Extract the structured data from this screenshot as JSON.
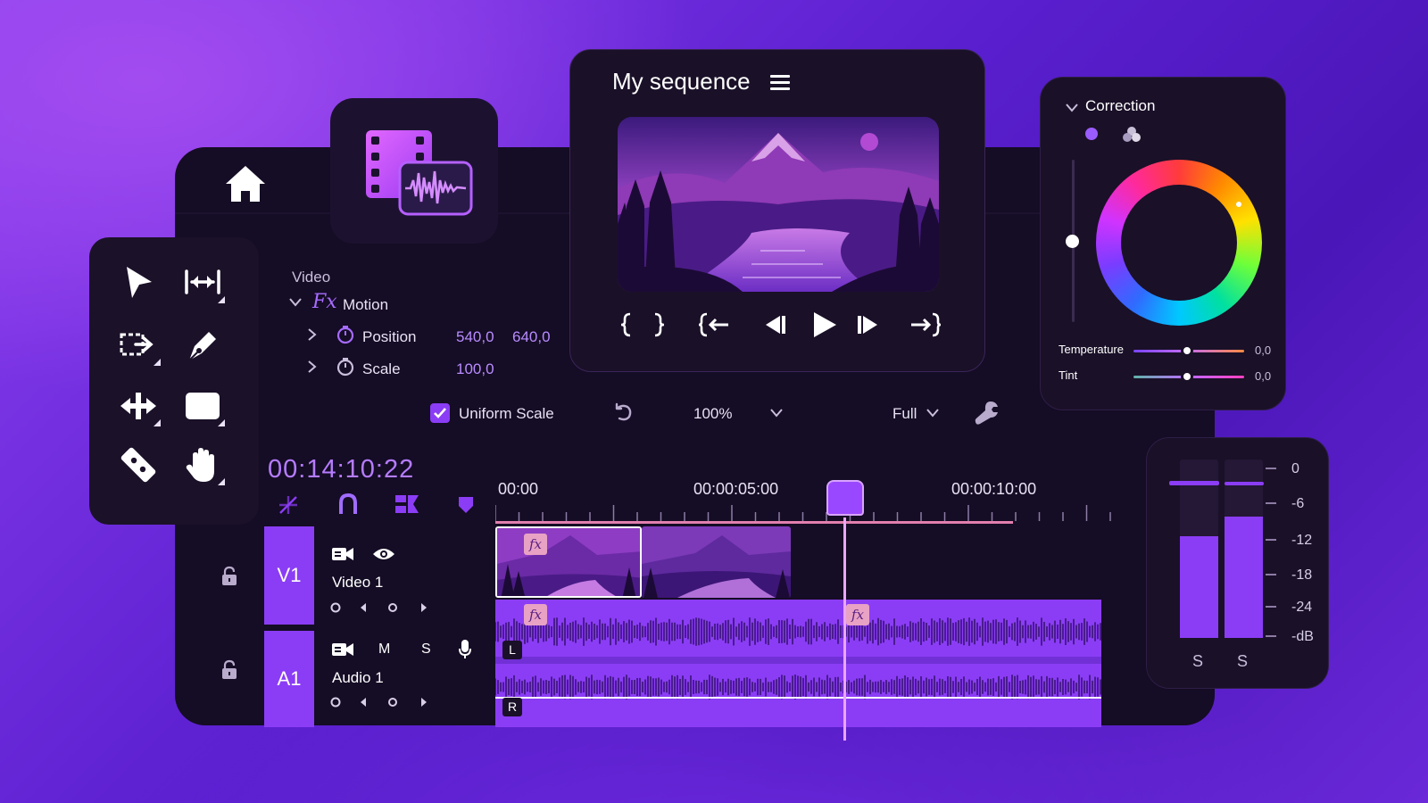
{
  "app": {
    "nav": {
      "home_icon": "home-icon",
      "media_icon": "film-audio-icon"
    }
  },
  "tools": {
    "items": [
      {
        "name": "selection-tool",
        "icon": "arrow-icon"
      },
      {
        "name": "ripple-edit-tool",
        "icon": "ripple-edit-icon"
      },
      {
        "name": "track-select-tool",
        "icon": "track-select-icon"
      },
      {
        "name": "pen-tool",
        "icon": "pen-icon"
      },
      {
        "name": "slip-tool",
        "icon": "slip-icon"
      },
      {
        "name": "rectangle-tool",
        "icon": "rectangle-icon"
      },
      {
        "name": "razor-tool",
        "icon": "razor-icon"
      },
      {
        "name": "hand-tool",
        "icon": "hand-icon"
      }
    ]
  },
  "effect_controls": {
    "section_label": "Video",
    "effect": {
      "fx": "Fx",
      "name": "Motion"
    },
    "params": [
      {
        "label": "Position",
        "values": [
          "540,0",
          "640,0"
        ]
      },
      {
        "label": "Scale",
        "values": [
          "100,0"
        ]
      }
    ],
    "uniform_scale": {
      "label": "Uniform Scale",
      "checked": true
    },
    "zoom": "100%",
    "quality": "Full"
  },
  "monitor": {
    "title": "My sequence",
    "menu_icon": "hamburger-icon",
    "transport": [
      "mark-in-icon",
      "mark-out-icon",
      "go-to-in-icon",
      "step-back-icon",
      "play-icon",
      "step-forward-icon",
      "go-to-out-icon"
    ]
  },
  "correction": {
    "title": "Correction",
    "temperature": {
      "label": "Temperature",
      "value": "0,0",
      "position": 0.48
    },
    "tint": {
      "label": "Tint",
      "value": "0,0",
      "position": 0.48
    }
  },
  "timeline": {
    "timecode": "00:14:10:22",
    "ruler": [
      "00:00",
      "00:00:05:00",
      "00:00:10:00"
    ],
    "tracks": {
      "video": {
        "id": "V1",
        "name": "Video 1"
      },
      "audio": {
        "id": "A1",
        "name": "Audio 1",
        "mute": "M",
        "solo": "S",
        "left": "L",
        "right": "R"
      }
    },
    "clip_fx": "fx"
  },
  "meters": {
    "scale": [
      "0",
      "-6",
      "-12",
      "-18",
      "-24",
      "-dB"
    ],
    "channels": [
      {
        "label": "S",
        "level": 0.57
      },
      {
        "label": "S",
        "level": 0.68
      }
    ]
  },
  "colors": {
    "accent": "#8b3df5",
    "accent_light": "#b57cff",
    "panel": "#160d26"
  }
}
